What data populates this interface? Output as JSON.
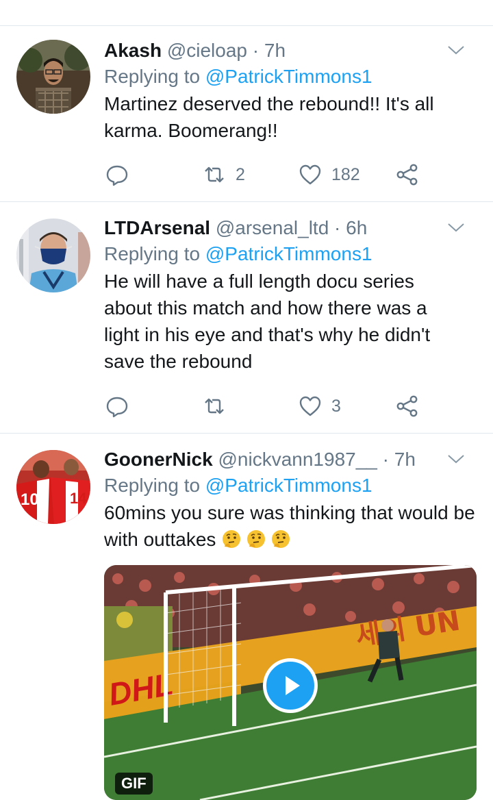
{
  "tweets": [
    {
      "name": "Akash",
      "handle": "@cieloap",
      "time": "· 7h",
      "replying_prefix": "Replying to",
      "replying_handle": "@PatrickTimmons1",
      "text": "Martinez deserved the rebound!! It's all karma. Boomerang!!",
      "retweets": "2",
      "likes": "182"
    },
    {
      "name": "LTDArsenal",
      "handle": "@arsenal_ltd",
      "time": "· 6h",
      "replying_prefix": "Replying to",
      "replying_handle": "@PatrickTimmons1",
      "text": "He will have a full length docu series about this match and how there was a light in his eye and that's why he didn't save the rebound",
      "retweets": "",
      "likes": "3"
    },
    {
      "name": "GoonerNick",
      "handle": "@nickvann1987__",
      "time": "· 7h",
      "replying_prefix": "Replying to",
      "replying_handle": "@PatrickTimmons1",
      "text": "60mins you sure was thinking that would be with outtakes",
      "emoji": "thinking-face-emoji",
      "media_badge": "GIF",
      "media_overlay_text": "세의 UN",
      "media_sponsor": "DHL"
    }
  ],
  "colors": {
    "accent": "#1da1f2",
    "text": "#14171a",
    "muted": "#657786",
    "divider": "#e1e8ed"
  }
}
